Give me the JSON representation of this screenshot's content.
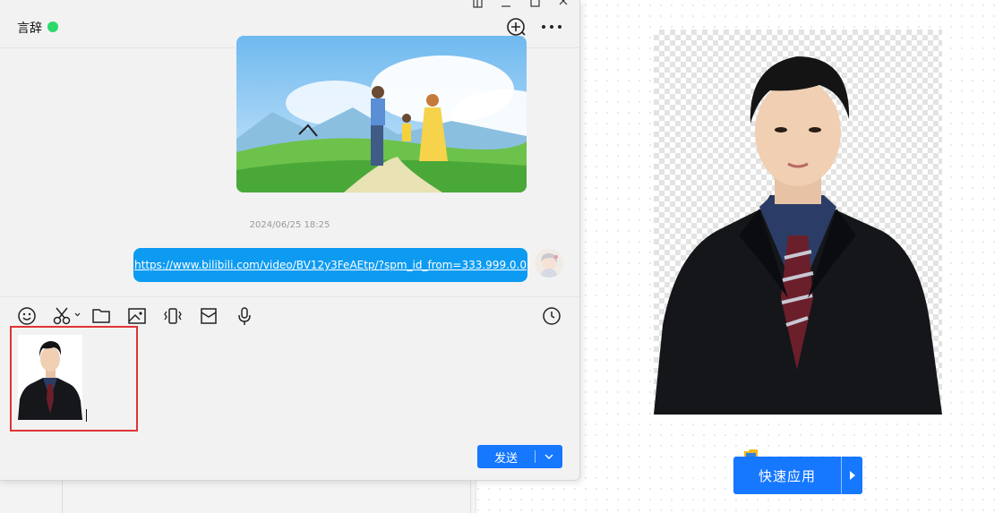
{
  "chat": {
    "contact_name": "言辞",
    "status_color": "#2dd86b",
    "icons": {
      "add": "add-circle-icon",
      "more": "more-dots-icon"
    },
    "messages": {
      "timestamp": "2024/06/25 18:25",
      "link_text": "https://www.bilibili.com/video/BV12y3FeAEtp/?spm_id_from=333.999.0.0",
      "link_bubble_color": "#0d9bf2"
    },
    "toolbar": [
      {
        "name": "emoji-icon"
      },
      {
        "name": "scissors-icon"
      },
      {
        "name": "folder-icon"
      },
      {
        "name": "image-icon"
      },
      {
        "name": "vibrate-icon"
      },
      {
        "name": "red-packet-icon"
      },
      {
        "name": "microphone-icon"
      },
      {
        "name": "history-clock-icon"
      }
    ],
    "send_label": "发送",
    "accent": "#1677ff",
    "highlight_color": "#e03434"
  },
  "editor": {
    "quick_apply_label": "快速应用"
  }
}
